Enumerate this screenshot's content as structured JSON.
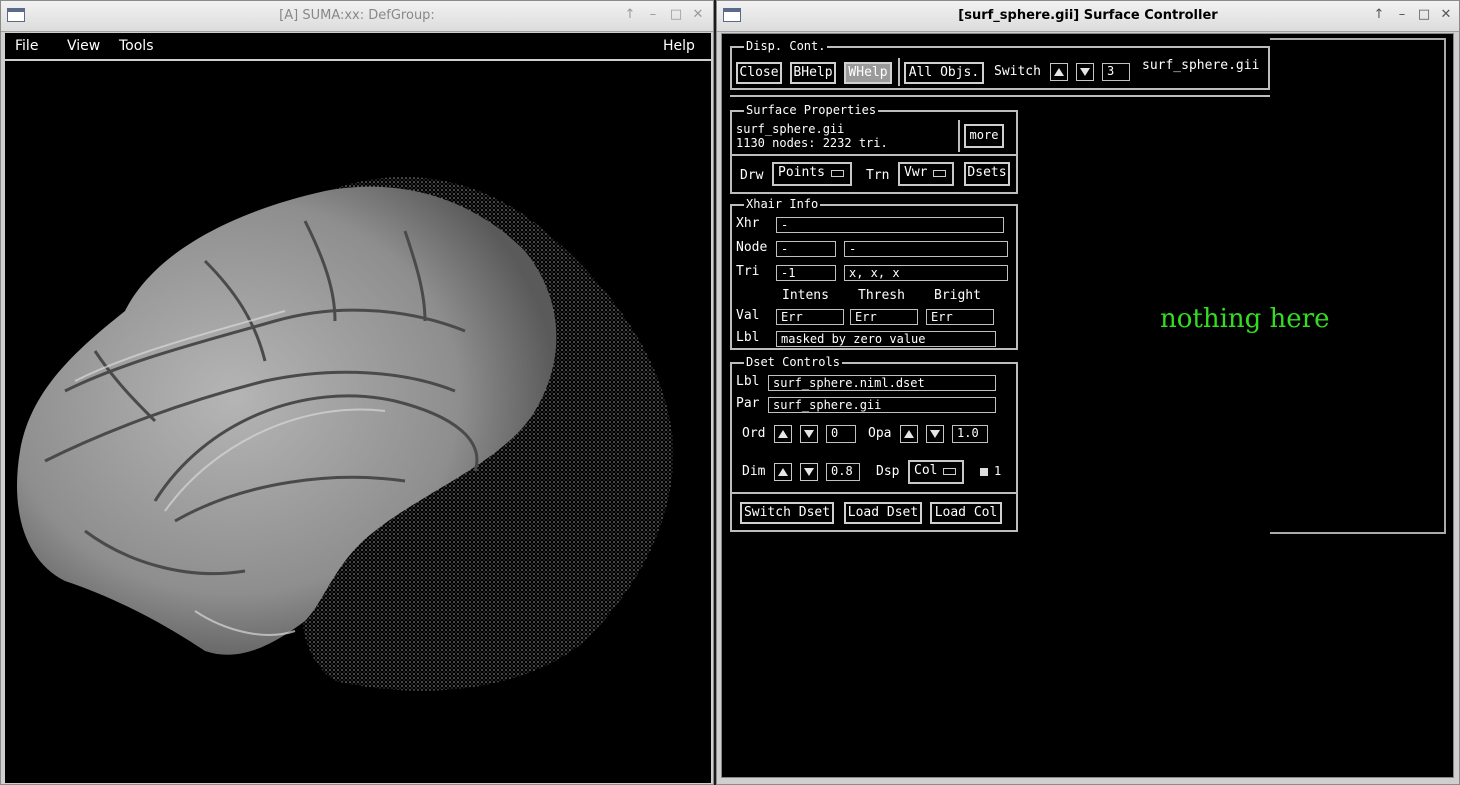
{
  "suma_window": {
    "title": "[A] SUMA:xx: DefGroup:",
    "menu": {
      "file": "File",
      "view": "View",
      "tools": "Tools",
      "help": "Help"
    }
  },
  "controller_window": {
    "title": "[surf_sphere.gii] Surface Controller",
    "disp_cont": {
      "legend": "Disp. Cont.",
      "close": "Close",
      "bhelp": "BHelp",
      "whelp": "WHelp",
      "all_objs": "All Objs.",
      "switch_label": "Switch",
      "switch_value": "3",
      "surface_name": "surf_sphere.gii"
    },
    "surface_properties": {
      "legend": "Surface Properties",
      "name": "surf_sphere.gii",
      "stats": "1130 nodes: 2232 tri.",
      "more": "more",
      "drw_label": "Drw",
      "drw_value": "Points",
      "trn_label": "Trn",
      "trn_value": "Vwr",
      "dsets": "Dsets"
    },
    "xhair_info": {
      "legend": "Xhair Info",
      "xhr_label": "Xhr",
      "xhr_value": "-",
      "node_label": "Node",
      "node_value": "-",
      "node_extra": "-",
      "tri_label": "Tri",
      "tri_value": "-1",
      "tri_extra": "x, x, x",
      "col_intens": "Intens",
      "col_thresh": "Thresh",
      "col_bright": "Bright",
      "val_label": "Val",
      "val_intens": "Err",
      "val_thresh": "Err",
      "val_bright": "Err",
      "lbl_label": "Lbl",
      "lbl_value": "masked by zero value"
    },
    "dset_controls": {
      "legend": "Dset Controls",
      "lbl_label": "Lbl",
      "lbl_value": "surf_sphere.niml.dset",
      "par_label": "Par",
      "par_value": "surf_sphere.gii",
      "ord_label": "Ord",
      "ord_value": "0",
      "opa_label": "Opa",
      "opa_value": "1.0",
      "dim_label": "Dim",
      "dim_value": "0.8",
      "dsp_label": "Dsp",
      "dsp_value": "Col",
      "check_label": "1",
      "switch_dset": "Switch Dset",
      "load_dset": "Load Dset",
      "load_col": "Load Col"
    },
    "empty_panel_text": "nothing here"
  },
  "colors": {
    "empty_panel_text": "#33dd22",
    "brain": "#bdbdbd"
  }
}
